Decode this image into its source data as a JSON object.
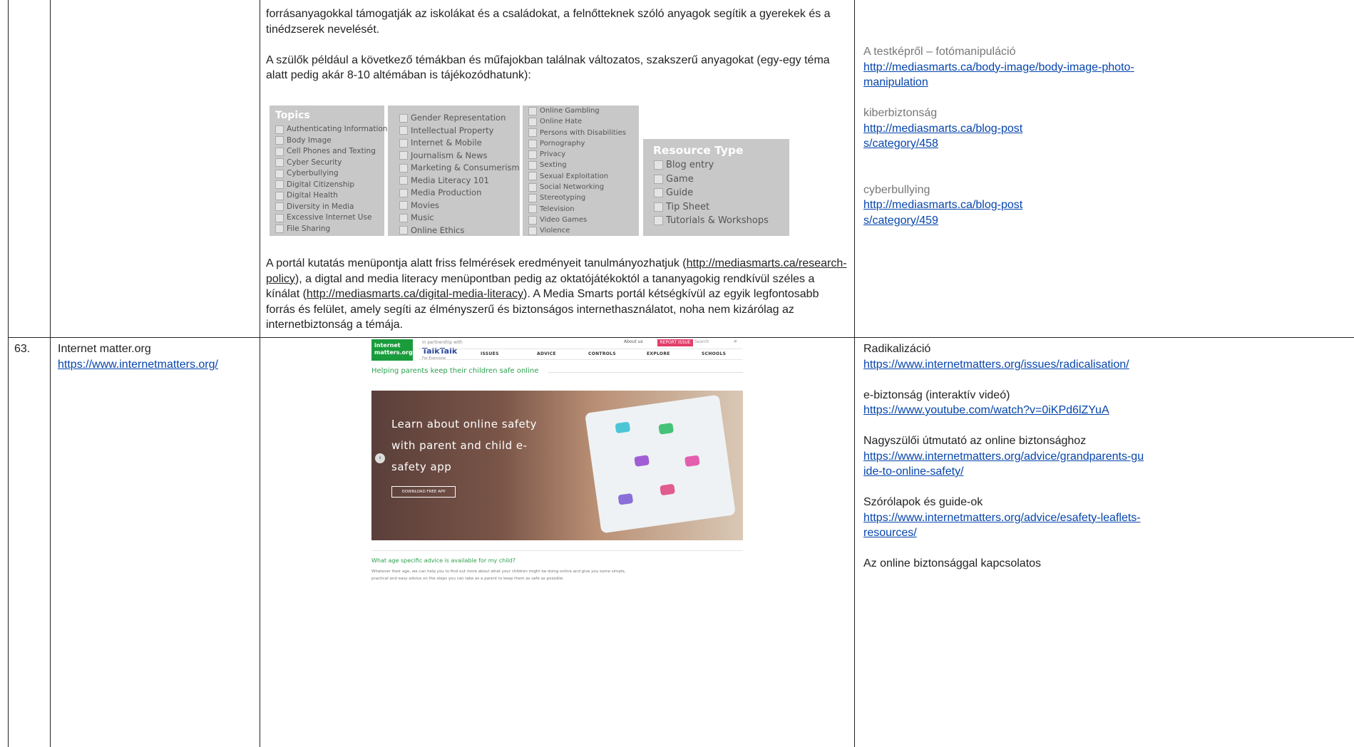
{
  "row_top": {
    "middle": {
      "p1": "forrásanyagokkal támogatják az iskolákat és a családokat, a felnőtteknek szóló anyagok segítik a gyerekek és a tinédzserek nevelését.",
      "p2": "A szülők például a következő témákban és műfajokban találnak változatos, szakszerű anyagokat (egy-egy téma alatt pedig akár 8-10 altémában is tájékozódhatunk):",
      "p3_a": "A portál kutatás menüpontja alatt friss felmérések eredményeit tanulmányozhatjuk (",
      "p3_link1": "http://mediasmarts.ca/research-policy",
      "p3_b": "), a digtal and media literacy menüpontban pedig az oktatójátékoktól a tananyagokig rendkívül széles a kínálat (",
      "p3_link2": "http://mediasmarts.ca/digital-media-literacy",
      "p3_c": "). A Media Smarts portál kétségkívül az egyik legfontosabb forrás és felület, amely segíti az élményszerű és biztonságos internethasználatot, noha nem kizárólag az internetbiztonság a témája."
    },
    "right": [
      {
        "title": "A testképről – fotómanipuláció",
        "link": "http://mediasmarts.ca/body-image/body-image-photo-manipulation"
      },
      {
        "title": "kiberbiztonság",
        "link": "http://mediasmarts.ca/blog-posts/category/458"
      },
      {
        "title": "cyberbullying",
        "link": "http://mediasmarts.ca/blog-posts/category/459"
      }
    ]
  },
  "topics_panel": {
    "title": "Topics",
    "col1": [
      "Authenticating Information",
      "Body Image",
      "Cell Phones and Texting",
      "Cyber Security",
      "Cyberbullying",
      "Digital Citizenship",
      "Digital Health",
      "Diversity in Media",
      "Excessive Internet Use",
      "File Sharing"
    ],
    "col2": [
      "Gender Representation",
      "Intellectual Property",
      "Internet & Mobile",
      "Journalism & News",
      "Marketing & Consumerism",
      "Media Literacy 101",
      "Media Production",
      "Movies",
      "Music",
      "Online Ethics"
    ],
    "col3": [
      "Online Gambling",
      "Online Hate",
      "Persons with Disabilities",
      "Pornography",
      "Privacy",
      "Sexting",
      "Sexual Exploitation",
      "Social Networking",
      "Stereotyping",
      "Television",
      "Video Games",
      "Violence"
    ],
    "resource_title": "Resource Type",
    "resource_items": [
      "Blog entry",
      "Game",
      "Guide",
      "Tip Sheet",
      "Tutorials & Workshops"
    ]
  },
  "row_63": {
    "number": "63.",
    "name": "Internet matter.org",
    "url": "https://www.internetmatters.org/",
    "right": [
      {
        "title": "Radikalizáció",
        "link": "https://www.internetmatters.org/issues/radicalisation/"
      },
      {
        "title": "e-biztonság (interaktív videó)",
        "link": "https://www.youtube.com/watch?v=0iKPd6lZYuA"
      },
      {
        "title": "Nagyszülői útmutató az online biztonsághoz",
        "link": "https://www.internetmatters.org/advice/grandparents-guide-to-online-safety/"
      },
      {
        "title": "Szórólapok és guide-ok",
        "link": "https://www.internetmatters.org/advice/esafety-leaflets-resources/"
      },
      {
        "title": "Az online biztonsággal kapcsolatos",
        "link": ""
      }
    ]
  },
  "website": {
    "logo_line1": "internet",
    "logo_line2": "matters.org",
    "partner_small": "in partnership with",
    "partner_name": "TalkTalk",
    "partner_tag": "For Everyone",
    "about": "About us",
    "report": "REPORT ISSUE",
    "search": "Search",
    "menu": [
      "ISSUES",
      "ADVICE",
      "CONTROLS",
      "EXPLORE",
      "SCHOOLS"
    ],
    "tagline": "Helping parents keep their children safe online",
    "hero_lines": [
      "Learn about online safety",
      "with parent and child e-",
      "safety app"
    ],
    "download": "DOWNLOAD FREE APP",
    "age_heading": "What age specific advice is available for my child?",
    "age_text": "Whatever their age, we can help you to find out more about what your children might be doing online and give you some simple, practical and easy advice on the steps you can take as a parent to keep them as safe as possible."
  }
}
